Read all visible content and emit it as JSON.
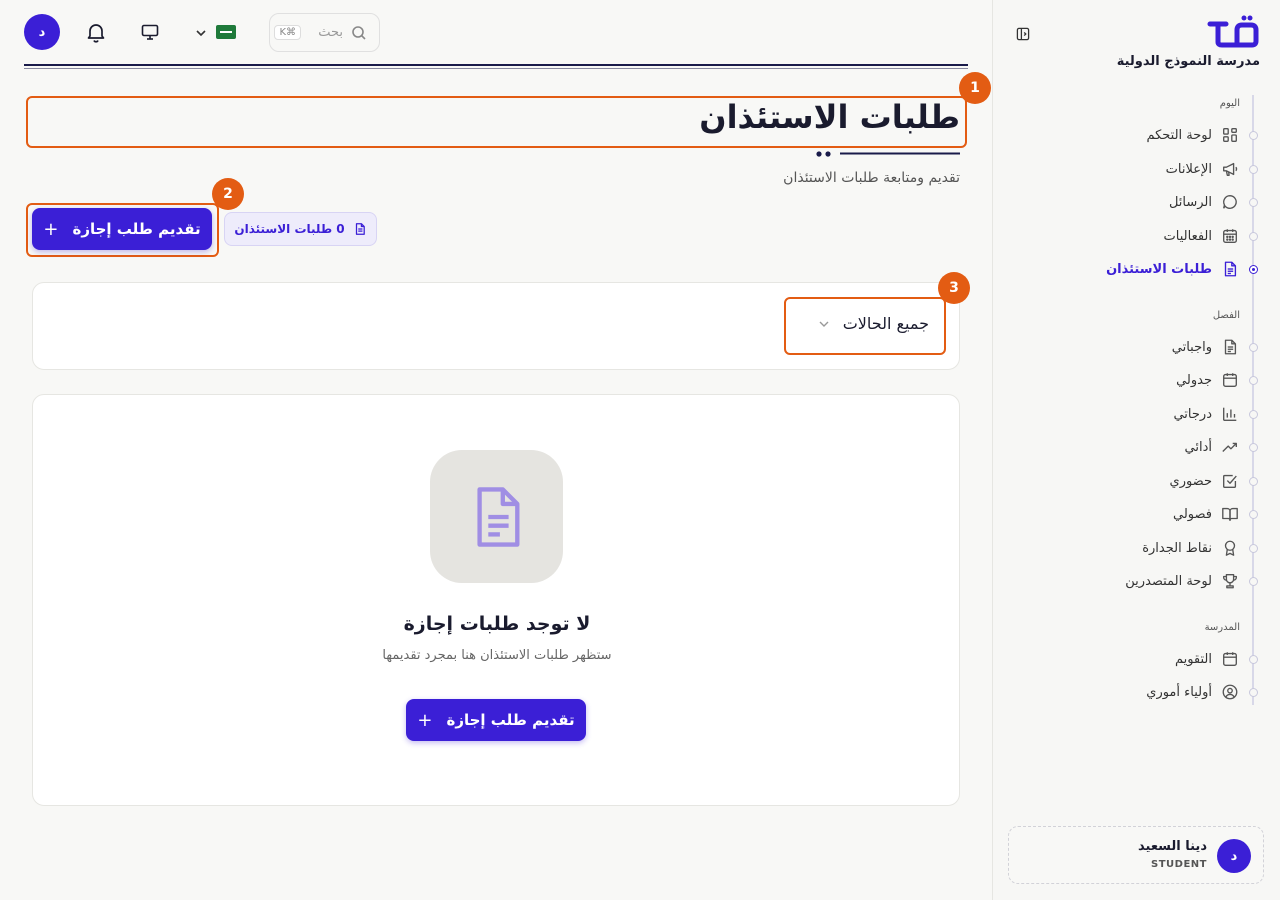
{
  "sidebar": {
    "school_name": "مدرسة النموذج الدولية",
    "sections": {
      "today": "اليوم",
      "class": "الفصل",
      "school": "المدرسة"
    },
    "items": [
      {
        "label": "لوحة التحكم",
        "icon": "dashboard-icon"
      },
      {
        "label": "الإعلانات",
        "icon": "megaphone-icon"
      },
      {
        "label": "الرسائل",
        "icon": "chat-icon"
      },
      {
        "label": "الفعاليات",
        "icon": "calendar-grid-icon"
      },
      {
        "label": "طلبات الاستئذان",
        "icon": "document-icon",
        "active": true
      },
      {
        "label": "واجباتي",
        "icon": "document-icon"
      },
      {
        "label": "جدولي",
        "icon": "calendar-icon"
      },
      {
        "label": "درجاتي",
        "icon": "bar-chart-icon"
      },
      {
        "label": "أدائي",
        "icon": "trending-up-icon"
      },
      {
        "label": "حضوري",
        "icon": "check-square-icon"
      },
      {
        "label": "فصولي",
        "icon": "book-open-icon"
      },
      {
        "label": "نقاط الجدارة",
        "icon": "award-icon"
      },
      {
        "label": "لوحة المتصدرين",
        "icon": "trophy-icon"
      },
      {
        "label": "التقويم",
        "icon": "calendar-icon"
      },
      {
        "label": "أولياء أموري",
        "icon": "user-circle-icon"
      }
    ],
    "user": {
      "initial": "د",
      "name": "دينا السعيد",
      "role": "STUDENT"
    }
  },
  "topbar": {
    "avatar_initial": "د",
    "search_placeholder": "بحث",
    "search_shortcut": "K⌘"
  },
  "main": {
    "title": "طلبات الاستئذان",
    "subtitle": "تقديم ومتابعة طلبات الاستئذان",
    "submit_button": "تقديم طلب إجازة",
    "count_chip": "0 طلبات الاستئذان",
    "status_filter": "جميع الحالات",
    "empty_title": "لا توجد طلبات إجازة",
    "empty_desc": "ستظهر طلبات الاستئذان هنا بمجرد تقديمها",
    "empty_button": "تقديم طلب إجازة"
  },
  "annotations": [
    "1",
    "2",
    "3"
  ],
  "colors": {
    "primary": "#3b1fd6",
    "highlight": "#e35c13"
  }
}
